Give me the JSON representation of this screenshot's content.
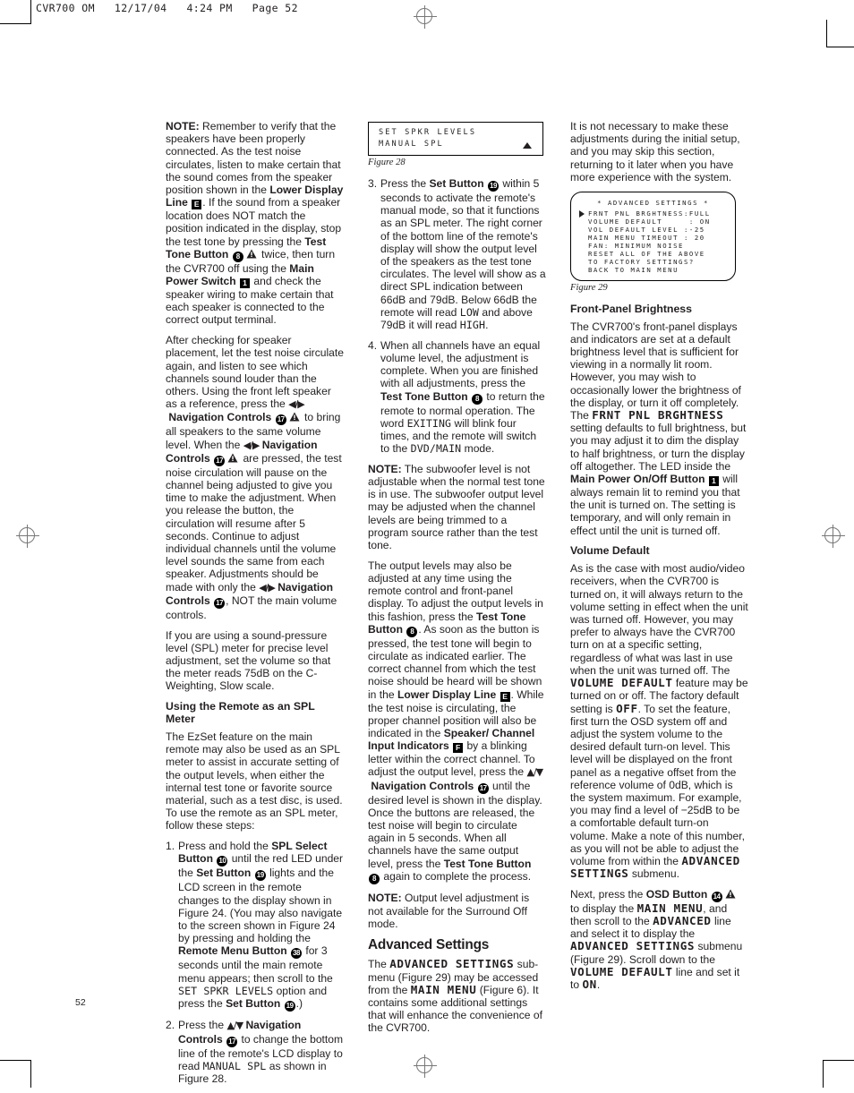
{
  "page": {
    "slug": "CVR700 OM   12/17/04   4:24 PM   Page 52",
    "folio": "52"
  },
  "figures": {
    "fig28": {
      "caption": "Figure 28",
      "line1": "SET SPKR LEVELS",
      "line2": "MANUAL SPL"
    },
    "fig29": {
      "caption": "Figure 29",
      "title": "* ADVANCED SETTINGS *",
      "rows": [
        "FRNT PNL BRGHTNESS:FULL",
        "VOLUME DEFAULT     : ON",
        "VOL DEFAULT LEVEL :-25",
        "MAIN MENU TIMEOUT : 20",
        "FAN: MINIMUM NOISE",
        "RESET ALL OF THE ABOVE",
        "TO FACTORY SETTINGS?",
        "BACK TO MAIN MENU"
      ]
    }
  },
  "column1": {
    "note1": {
      "label": "NOTE:",
      "t1": " Remember to verify that the speakers have been properly connected. As the test noise circulates, listen to make certain that the sound comes from the speaker position shown in the ",
      "b1": "Lower Display Line",
      "icon1": "E",
      "t2": ". If the sound from a speaker location does NOT match the position indicated in the display, stop the test tone by pressing the ",
      "b2": "Test Tone Button",
      "icon2": "8",
      "t3": " twice, then turn the CVR700 off using the ",
      "b3": "Main Power Switch",
      "icon3": "1",
      "t4": " and check the speaker wiring to make certain that each speaker is connected to the correct output terminal."
    },
    "para2": {
      "t1": "After checking for speaker placement, let the test noise circulate again, and listen to see which channels sound louder than the others. Using the front left speaker as a reference, press the ",
      "b1": "Navigation Controls",
      "icon1": "17",
      "t2": " to bring all speakers to the same volume level. When the ",
      "b2": "Navigation Controls",
      "icon2": "17",
      "t3": " are pressed, the test noise circulation will pause on the channel being adjusted to give you time to make the adjustment. When you release the button, the circulation will resume after 5 seconds. Continue to adjust individual channels until the volume level sounds the same from each speaker. Adjustments should be made with only the ",
      "b3": "Navigation Controls",
      "icon3": "17",
      "t4": ", NOT the main volume controls."
    },
    "para3": "If you are using a sound-pressure level (SPL) meter for precise level adjustment, set the volume so that the meter reads 75dB on the C-Weighting, Slow scale.",
    "heading1": "Using the Remote as an SPL Meter",
    "para4": "The EzSet feature on the main remote may also be used as an SPL meter to assist in accurate setting of the output levels, when either the internal test tone or favorite source material, such as a test disc, is used. To use the remote as an SPL meter, follow these steps:",
    "step1": {
      "num": "1.",
      "t1": "Press and hold the ",
      "b1": "SPL Select Button",
      "icon1": "10",
      "t2": " until the red LED under the ",
      "b2": "Set Button",
      "icon2": "19",
      "t3": " lights and the LCD screen in the remote changes to the display shown in Figure 24. (You may also navigate to the screen shown in Figure 24 by pressing and holding the ",
      "b3": "Remote Menu Button",
      "icon3": "38",
      "t4": " for 3 seconds until the main remote menu appears; then scroll to the ",
      "lcd1": "SET SPKR LEVELS",
      "t5": " option and press the ",
      "b4": "Set Button",
      "icon4": "19",
      "t6": ".)"
    },
    "step2": {
      "num": "2.",
      "t1": "Press the ",
      "b1": "Navigation Controls",
      "icon1": "17",
      "t2": " to change the bottom line of the remote's LCD display to read ",
      "lcd1": "MANUAL SPL",
      "t3": " as shown in Figure 28."
    }
  },
  "column2": {
    "step3": {
      "num": "3.",
      "t1": "Press the ",
      "b1": "Set Button",
      "icon1": "19",
      "t2": " within 5 seconds to activate the remote's manual mode, so that it functions as an SPL meter. The right corner of the bottom line of the remote's display will show the output level of the speakers as the test tone circulates. The level will show as a direct SPL indication between 66dB and 79dB. Below 66dB the remote will read ",
      "lcd1": "LOW",
      "t3": " and above 79dB it will read ",
      "lcd2": "HIGH",
      "t4": "."
    },
    "step4": {
      "num": "4.",
      "t1": "When all channels have an equal volume level, the adjustment is complete. When you are finished with all adjustments, press the ",
      "b1": "Test Tone Button",
      "icon1": "8",
      "t2": " to return the remote to normal operation. The word ",
      "lcd1": "EXITING",
      "t3": " will blink four times, and the remote will switch to the ",
      "lcd2": "DVD/MAIN",
      "t4": " mode."
    },
    "note2": {
      "label": "NOTE:",
      "t1": " The subwoofer level is not adjustable when the normal test tone is in use. The subwoofer output level may be adjusted when the channel levels are being trimmed to a program source rather than the test tone."
    },
    "para1": {
      "t1": "The output levels may also be adjusted at any time using the remote control and front-panel display. To adjust the output levels in this fashion, press the ",
      "b1": "Test Tone Button",
      "icon1": "8",
      "t2": ". As soon as the button is pressed, the test tone will begin to circulate as indicated earlier. The correct channel from which the test noise should be heard will be shown in the ",
      "b2": "Lower Display Line",
      "icon2": "E",
      "t3": ". While the test noise is circulating, the proper channel position will also be indicated in the ",
      "b3": "Speaker/ Channel Input Indicators",
      "icon3": "F",
      "t4": " by a blinking letter within the correct channel. To adjust the output level, press the ",
      "b4": "Navigation Controls",
      "icon4": "17",
      "t5": " until the desired level is shown in the display. Once the buttons are released, the test noise will begin to circulate again in 5 seconds. When all channels have the same output level, press the ",
      "b5": "Test Tone Button",
      "icon5": "8",
      "t6": " again to complete the process."
    },
    "note3": {
      "label": "NOTE:",
      "t1": " Output level adjustment is not available for the Surround Off mode."
    },
    "heading1": "Advanced Settings",
    "para2": {
      "t1": "The ",
      "lcd1": "ADVANCED SETTINGS",
      "t2": " sub-menu (Figure 29) may be accessed from the ",
      "lcd2": "MAIN MENU",
      "t3": " (Figure 6). It contains some additional settings that will enhance the convenience of the CVR700."
    }
  },
  "column3": {
    "para1": "It is not necessary to make these adjustments during the initial setup, and you may skip this section, returning to it later when you have more experience with the system.",
    "heading1": "Front-Panel Brightness",
    "para2": {
      "t1": "The CVR700's front-panel displays and indicators are set at a default brightness level that is sufficient for viewing in a normally lit room. However, you may wish to occasionally lower the brightness of the display, or turn it off completely. The ",
      "lcd1": "FRNT PNL BRGHTNESS",
      "t2": " setting defaults to full brightness, but you may adjust it to dim the display to half brightness, or turn the display off altogether. The LED inside the ",
      "b1": "Main Power On/Off Button",
      "icon1": "1",
      "t3": " will always remain lit to remind you that the unit is turned on. The setting is temporary, and will only remain in effect until the unit is turned off."
    },
    "heading2": "Volume Default",
    "para3": {
      "t1": "As is the case with most audio/video receivers, when the CVR700 is turned on, it will always return to the volume setting in effect when the unit was turned off. However, you may prefer to always have the CVR700 turn on at a specific setting, regardless of what was last in use when the unit was turned off. The ",
      "lcd1": "VOLUME DEFAULT",
      "t2": " feature may be turned on or off. The factory default setting is ",
      "lcd2": "OFF",
      "t3": ". To set the feature, first turn the OSD system off and adjust the system volume to the desired default turn-on level. This level will be displayed on the front panel as a negative offset from the reference volume of 0dB, which is the system maximum. For example, you may find a level of −25dB to be a comfortable default turn-on volume. Make a note of this number, as you will not be able to adjust the volume from within the ",
      "lcd3": "ADVANCED SETTINGS",
      "t4": " submenu."
    },
    "para4": {
      "t1": "Next, press the ",
      "b1": "OSD Button",
      "icon1": "14",
      "t2": " to display the ",
      "lcd1": "MAIN MENU",
      "t3": ", and then scroll to the ",
      "lcd2": "ADVANCED",
      "t4": " line and select it to display the ",
      "lcd3": "ADVANCED SETTINGS",
      "t5": " submenu (Figure 29). Scroll down to the ",
      "lcd4": "VOLUME DEFAULT",
      "t6": " line and set it to ",
      "lcd5": "ON",
      "t7": "."
    }
  }
}
